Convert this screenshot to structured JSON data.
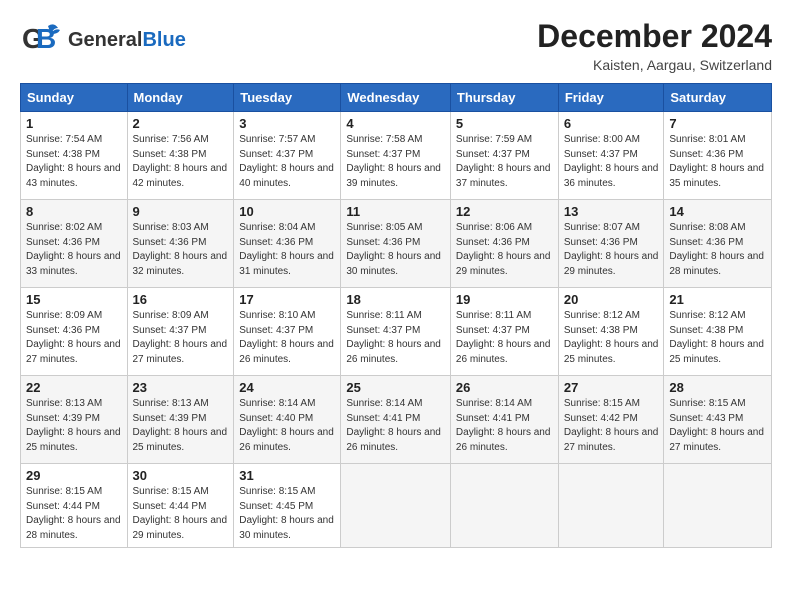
{
  "header": {
    "logo_general": "General",
    "logo_blue": "Blue",
    "month_title": "December 2024",
    "location": "Kaisten, Aargau, Switzerland"
  },
  "days_of_week": [
    "Sunday",
    "Monday",
    "Tuesday",
    "Wednesday",
    "Thursday",
    "Friday",
    "Saturday"
  ],
  "weeks": [
    [
      {
        "day": 1,
        "sunrise": "7:54 AM",
        "sunset": "4:38 PM",
        "daylight": "8 hours and 43 minutes."
      },
      {
        "day": 2,
        "sunrise": "7:56 AM",
        "sunset": "4:38 PM",
        "daylight": "8 hours and 42 minutes."
      },
      {
        "day": 3,
        "sunrise": "7:57 AM",
        "sunset": "4:37 PM",
        "daylight": "8 hours and 40 minutes."
      },
      {
        "day": 4,
        "sunrise": "7:58 AM",
        "sunset": "4:37 PM",
        "daylight": "8 hours and 39 minutes."
      },
      {
        "day": 5,
        "sunrise": "7:59 AM",
        "sunset": "4:37 PM",
        "daylight": "8 hours and 37 minutes."
      },
      {
        "day": 6,
        "sunrise": "8:00 AM",
        "sunset": "4:37 PM",
        "daylight": "8 hours and 36 minutes."
      },
      {
        "day": 7,
        "sunrise": "8:01 AM",
        "sunset": "4:36 PM",
        "daylight": "8 hours and 35 minutes."
      }
    ],
    [
      {
        "day": 8,
        "sunrise": "8:02 AM",
        "sunset": "4:36 PM",
        "daylight": "8 hours and 33 minutes."
      },
      {
        "day": 9,
        "sunrise": "8:03 AM",
        "sunset": "4:36 PM",
        "daylight": "8 hours and 32 minutes."
      },
      {
        "day": 10,
        "sunrise": "8:04 AM",
        "sunset": "4:36 PM",
        "daylight": "8 hours and 31 minutes."
      },
      {
        "day": 11,
        "sunrise": "8:05 AM",
        "sunset": "4:36 PM",
        "daylight": "8 hours and 30 minutes."
      },
      {
        "day": 12,
        "sunrise": "8:06 AM",
        "sunset": "4:36 PM",
        "daylight": "8 hours and 29 minutes."
      },
      {
        "day": 13,
        "sunrise": "8:07 AM",
        "sunset": "4:36 PM",
        "daylight": "8 hours and 29 minutes."
      },
      {
        "day": 14,
        "sunrise": "8:08 AM",
        "sunset": "4:36 PM",
        "daylight": "8 hours and 28 minutes."
      }
    ],
    [
      {
        "day": 15,
        "sunrise": "8:09 AM",
        "sunset": "4:36 PM",
        "daylight": "8 hours and 27 minutes."
      },
      {
        "day": 16,
        "sunrise": "8:09 AM",
        "sunset": "4:37 PM",
        "daylight": "8 hours and 27 minutes."
      },
      {
        "day": 17,
        "sunrise": "8:10 AM",
        "sunset": "4:37 PM",
        "daylight": "8 hours and 26 minutes."
      },
      {
        "day": 18,
        "sunrise": "8:11 AM",
        "sunset": "4:37 PM",
        "daylight": "8 hours and 26 minutes."
      },
      {
        "day": 19,
        "sunrise": "8:11 AM",
        "sunset": "4:37 PM",
        "daylight": "8 hours and 26 minutes."
      },
      {
        "day": 20,
        "sunrise": "8:12 AM",
        "sunset": "4:38 PM",
        "daylight": "8 hours and 25 minutes."
      },
      {
        "day": 21,
        "sunrise": "8:12 AM",
        "sunset": "4:38 PM",
        "daylight": "8 hours and 25 minutes."
      }
    ],
    [
      {
        "day": 22,
        "sunrise": "8:13 AM",
        "sunset": "4:39 PM",
        "daylight": "8 hours and 25 minutes."
      },
      {
        "day": 23,
        "sunrise": "8:13 AM",
        "sunset": "4:39 PM",
        "daylight": "8 hours and 25 minutes."
      },
      {
        "day": 24,
        "sunrise": "8:14 AM",
        "sunset": "4:40 PM",
        "daylight": "8 hours and 26 minutes."
      },
      {
        "day": 25,
        "sunrise": "8:14 AM",
        "sunset": "4:41 PM",
        "daylight": "8 hours and 26 minutes."
      },
      {
        "day": 26,
        "sunrise": "8:14 AM",
        "sunset": "4:41 PM",
        "daylight": "8 hours and 26 minutes."
      },
      {
        "day": 27,
        "sunrise": "8:15 AM",
        "sunset": "4:42 PM",
        "daylight": "8 hours and 27 minutes."
      },
      {
        "day": 28,
        "sunrise": "8:15 AM",
        "sunset": "4:43 PM",
        "daylight": "8 hours and 27 minutes."
      }
    ],
    [
      {
        "day": 29,
        "sunrise": "8:15 AM",
        "sunset": "4:44 PM",
        "daylight": "8 hours and 28 minutes."
      },
      {
        "day": 30,
        "sunrise": "8:15 AM",
        "sunset": "4:44 PM",
        "daylight": "8 hours and 29 minutes."
      },
      {
        "day": 31,
        "sunrise": "8:15 AM",
        "sunset": "4:45 PM",
        "daylight": "8 hours and 30 minutes."
      },
      null,
      null,
      null,
      null
    ]
  ]
}
